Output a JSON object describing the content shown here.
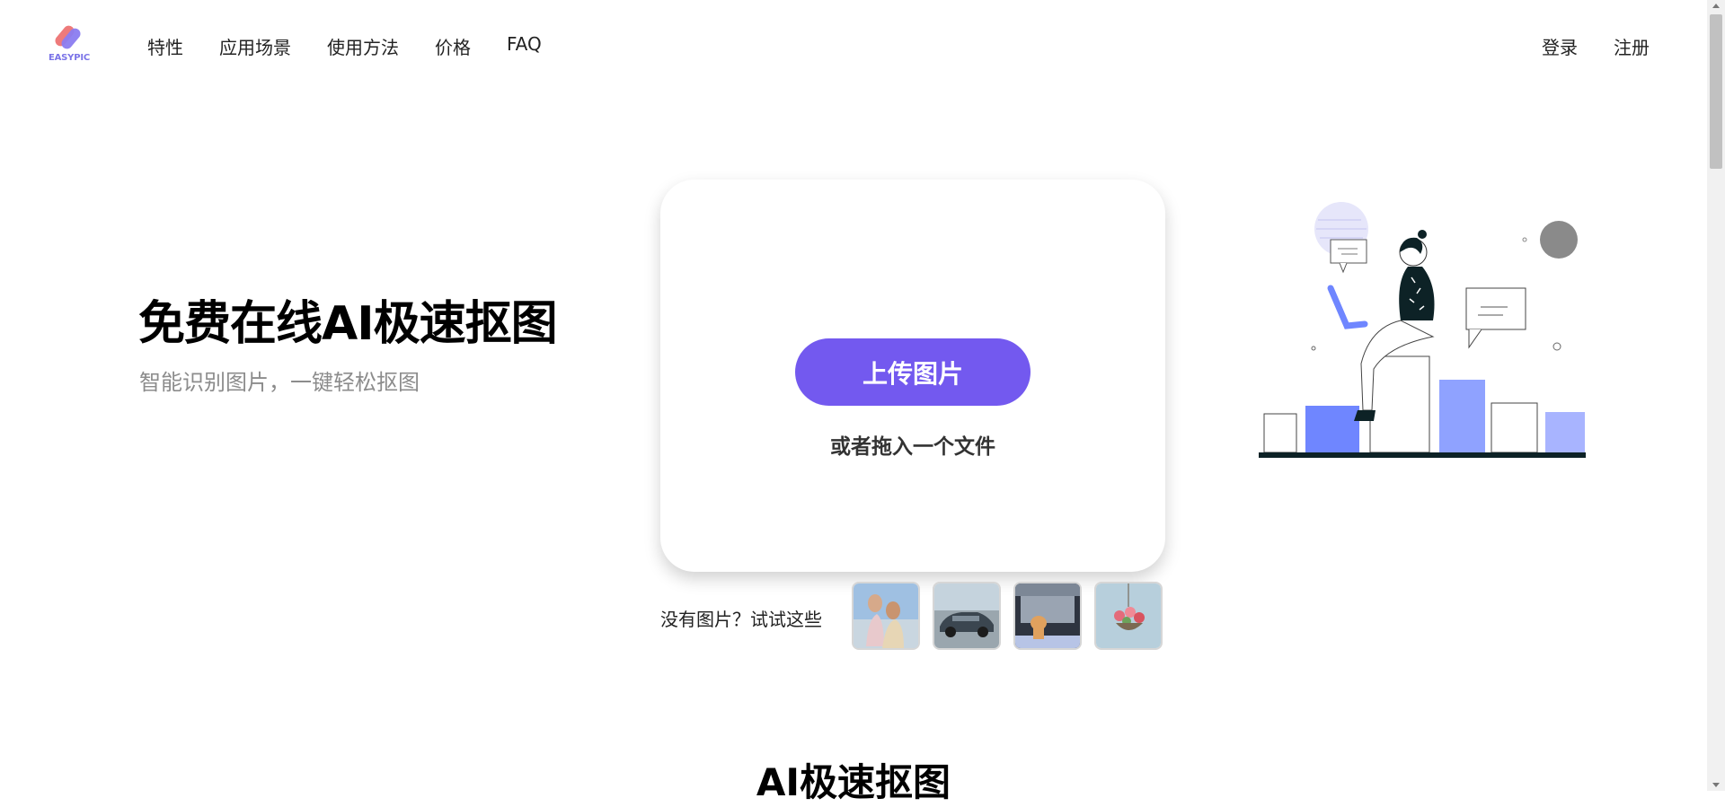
{
  "brand": {
    "logo_text": "EASYPIC",
    "logo_colors": [
      "#ee7a7a",
      "#8a7cf0"
    ]
  },
  "nav": {
    "items": [
      {
        "label": "特性"
      },
      {
        "label": "应用场景"
      },
      {
        "label": "使用方法"
      },
      {
        "label": "价格"
      },
      {
        "label": "FAQ"
      }
    ]
  },
  "auth": {
    "login": "登录",
    "register": "注册"
  },
  "hero": {
    "title": "免费在线AI极速抠图",
    "subtitle": "智能识别图片，一键轻松抠图"
  },
  "upload": {
    "button_label": "上传图片",
    "drag_text": "或者拖入一个文件",
    "accent_color": "#7359ef"
  },
  "samples": {
    "label": "没有图片？试试这些",
    "items": [
      {
        "name": "women-portrait"
      },
      {
        "name": "car"
      },
      {
        "name": "cat-in-car"
      },
      {
        "name": "flower-basket"
      }
    ]
  },
  "section": {
    "title": "AI极速抠图"
  },
  "colors": {
    "primary": "#7359ef",
    "bar_blue": "#7b8cff",
    "bar_light": "#a8b4ff",
    "text_gray": "#8c8c8c"
  }
}
